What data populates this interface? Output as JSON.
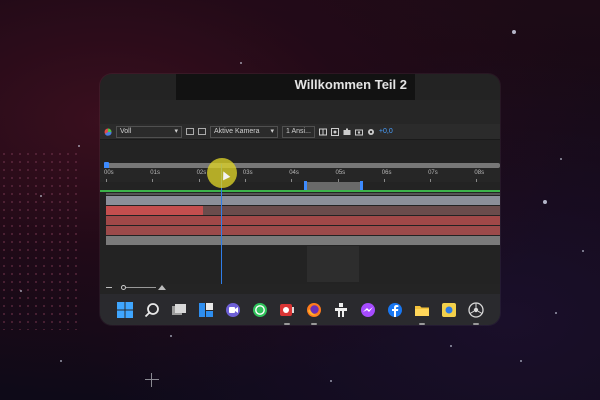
{
  "window": {
    "title": "Willkommen Teil 2"
  },
  "viewer_bar": {
    "zoom_value": "Voll",
    "camera_value": "Aktive Kamera",
    "view_value": "1 Ansi...",
    "exposure_value": "+0,0"
  },
  "timeline": {
    "ruler_labels": [
      "00s",
      "01s",
      "02s",
      "03s",
      "04s",
      "05s",
      "06s",
      "07s",
      "08s"
    ],
    "playhead_time_s": 2.6
  },
  "taskbar": {
    "apps": [
      {
        "name": "windows-start-icon"
      },
      {
        "name": "search-icon"
      },
      {
        "name": "task-view-icon"
      },
      {
        "name": "widgets-icon"
      },
      {
        "name": "teams-icon"
      },
      {
        "name": "whatsapp-icon"
      },
      {
        "name": "screen-recorder-icon"
      },
      {
        "name": "firefox-icon"
      },
      {
        "name": "game-icon"
      },
      {
        "name": "messenger-icon"
      },
      {
        "name": "facebook-icon"
      },
      {
        "name": "file-explorer-icon"
      },
      {
        "name": "photos-icon"
      },
      {
        "name": "chrome-app-icon"
      }
    ]
  },
  "colors": {
    "accent": "#3d8bff",
    "work_area_green": "#3cb34a",
    "layer_red": "#c44e4e",
    "playhead_highlight": "#dcd228"
  }
}
